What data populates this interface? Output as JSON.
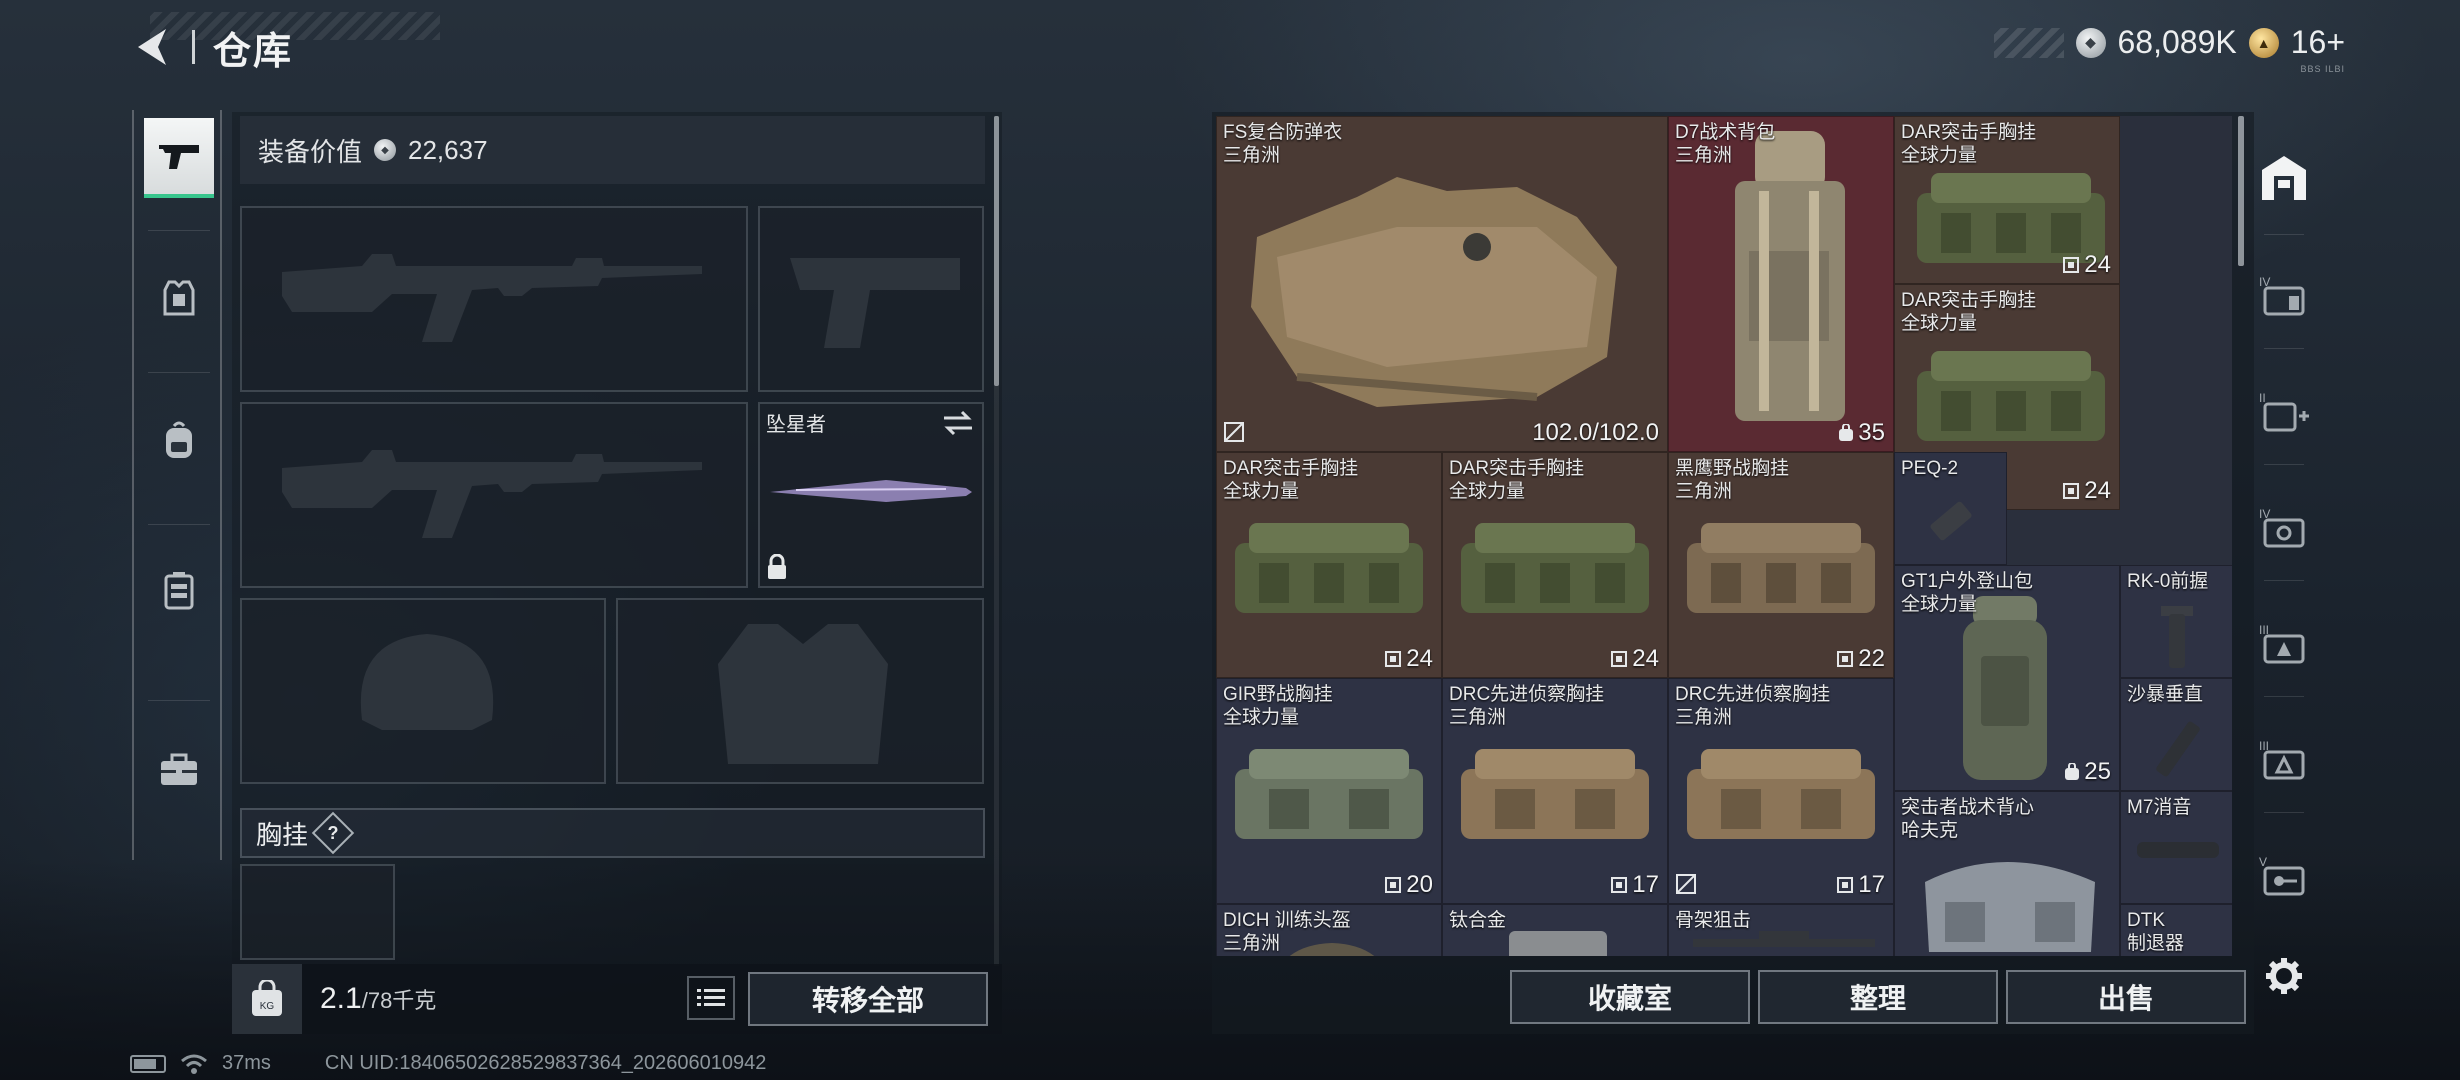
{
  "header": {
    "title": "仓库"
  },
  "currency": {
    "silver_value": "68,089K",
    "gold_value": "16+",
    "sub_text": "BBS ILBI"
  },
  "left_panel": {
    "equipment_value_label": "装备价值",
    "equipment_value": "22,637",
    "melee_name": "坠星者",
    "section_label": "胸挂",
    "section_help": "?",
    "weight_value": "2.1",
    "weight_capacity": "/78千克",
    "transfer_all_label": "转移全部"
  },
  "sidebar_left": {
    "tabs": [
      "weapon-icon",
      "armor-icon",
      "backpack-icon",
      "chest-rig-icon",
      "toolbox-icon"
    ]
  },
  "inventory": {
    "items": [
      {
        "name": "FS复合防弹衣",
        "tag": "三角洲",
        "count": "102.0/102.0"
      },
      {
        "name": "D7战术背包",
        "tag": "三角洲",
        "count": "35"
      },
      {
        "name": "DAR突击手胸挂",
        "tag": "全球力量",
        "count": "24"
      },
      {
        "name": "DAR突击手胸挂",
        "tag": "全球力量",
        "count": "24"
      },
      {
        "name": "DAR突击手胸挂",
        "tag": "全球力量",
        "count": "24"
      },
      {
        "name": "DAR突击手胸挂",
        "tag": "全球力量",
        "count": "24"
      },
      {
        "name": "黑鹰野战胸挂",
        "tag": "三角洲",
        "count": "22"
      },
      {
        "name": "PEQ-2",
        "tag": "",
        "count": ""
      },
      {
        "name": "GT1户外登山包",
        "tag": "全球力量",
        "count": "25"
      },
      {
        "name": "RK-0前握",
        "tag": "",
        "count": ""
      },
      {
        "name": "GIR野战胸挂",
        "tag": "全球力量",
        "count": "20"
      },
      {
        "name": "DRC先进侦察胸挂",
        "tag": "三角洲",
        "count": "17"
      },
      {
        "name": "DRC先进侦察胸挂",
        "tag": "三角洲",
        "count": "17"
      },
      {
        "name": "沙暴垂直",
        "tag": "",
        "count": ""
      },
      {
        "name": "突击者战术背心",
        "tag": "哈夫克",
        "count": ""
      },
      {
        "name": "M7消音",
        "tag": "",
        "count": ""
      },
      {
        "name": "DICH 训练头盔",
        "tag": "三角洲",
        "count": ""
      },
      {
        "name": "钛合金",
        "tag": "",
        "count": ""
      },
      {
        "name": "骨架狙击",
        "tag": "",
        "count": ""
      },
      {
        "name": "DTK",
        "tag": "制退器",
        "count": ""
      }
    ],
    "colors": {
      "brown": "#4a3a34",
      "red": "#5a2a32",
      "blue": "#2e3244"
    }
  },
  "buttons": {
    "collection": "收藏室",
    "organize": "整理",
    "sell": "出售"
  },
  "status": {
    "ping": "37ms",
    "uid": "CN UID:18406502628529837364_202606010942"
  }
}
